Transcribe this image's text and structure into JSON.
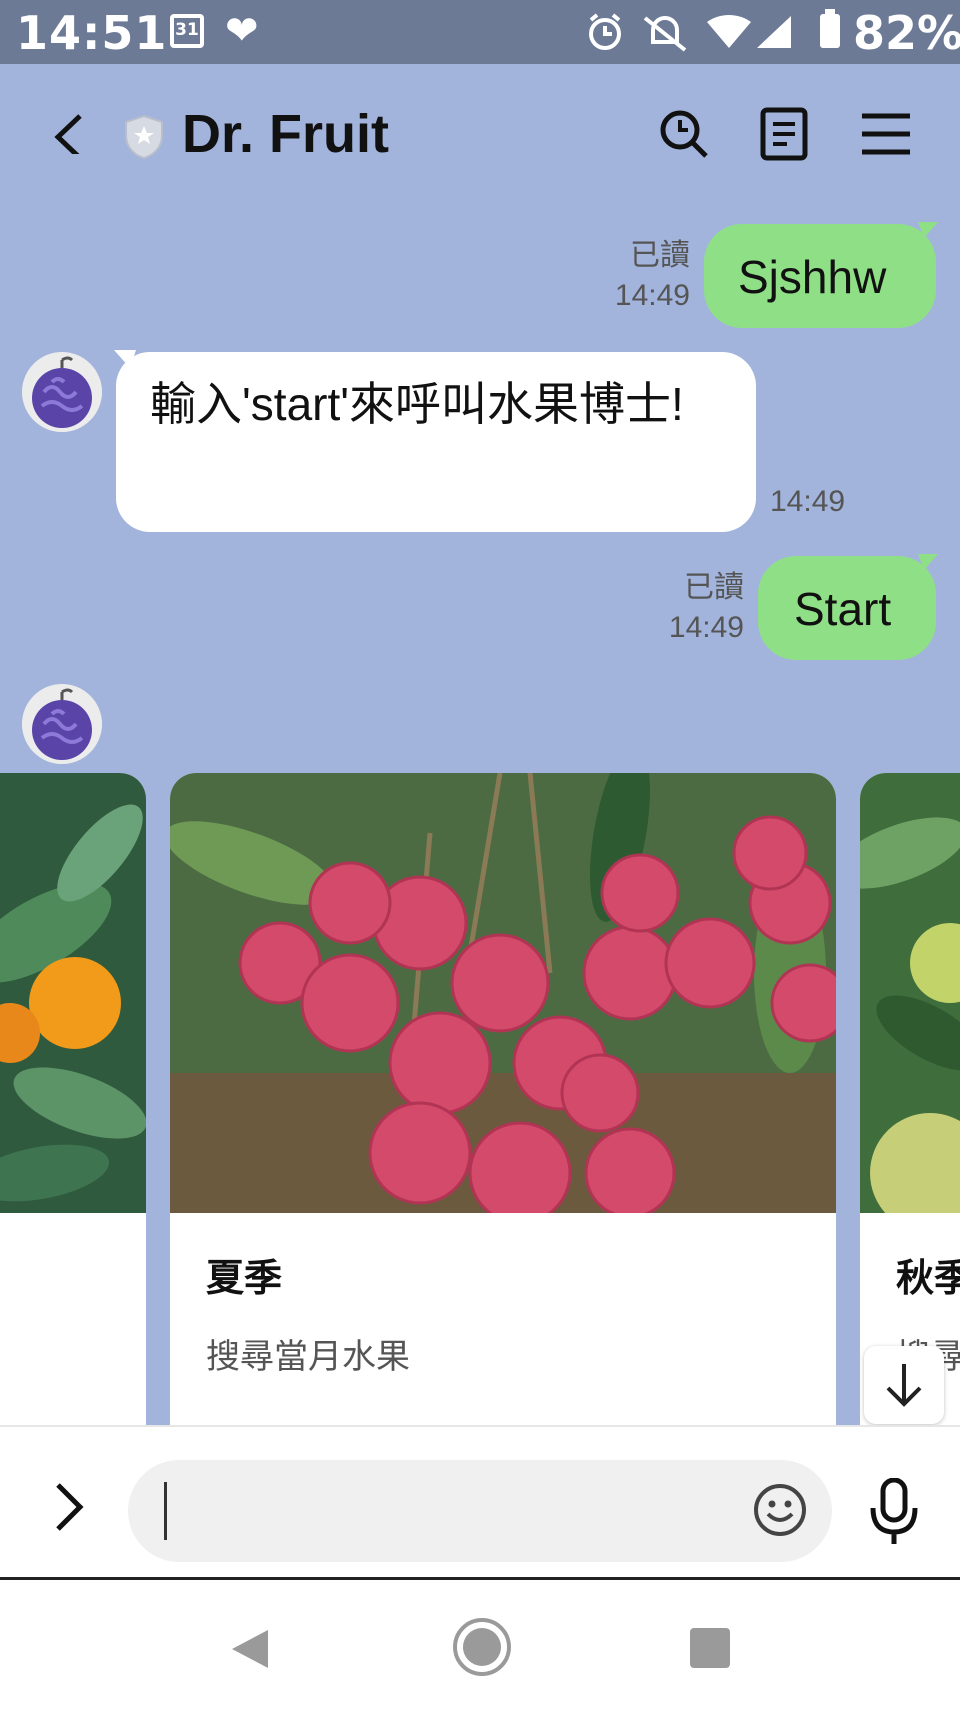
{
  "status_bar": {
    "time": "14:51",
    "calendar_day": "31",
    "battery": "82%"
  },
  "header": {
    "title": "Dr. Fruit"
  },
  "messages": [
    {
      "direction": "out",
      "text": "Sjshhw",
      "read_label": "已讀",
      "time": "14:49"
    },
    {
      "direction": "in",
      "text": "輸入'start'來呼叫水果博士!",
      "time": "14:49"
    },
    {
      "direction": "out",
      "text": "Start",
      "read_label": "已讀",
      "time": "14:49"
    }
  ],
  "carousel": {
    "cards": [
      {
        "title": "夏季",
        "subtitle": "搜尋當月水果",
        "image": "lychee-photo"
      },
      {
        "title": "秋季",
        "subtitle": "搜尋當月水果",
        "image": "pomelo-photo"
      },
      {
        "title": "",
        "subtitle": "",
        "image": "orange-photo"
      }
    ]
  },
  "input": {
    "placeholder": ""
  },
  "colors": {
    "chat_background": "#a2b4dc",
    "outgoing_bubble": "#8fdf86",
    "incoming_bubble": "#ffffff",
    "status_bar": "#6c7a96"
  },
  "icons": [
    "back-icon",
    "shield-icon",
    "search-icon",
    "note-icon",
    "menu-icon",
    "avatar-icon",
    "arrow-down-icon",
    "chevron-right-icon",
    "emoji-icon",
    "mic-icon",
    "nav-back-icon",
    "nav-home-icon",
    "nav-recent-icon"
  ]
}
